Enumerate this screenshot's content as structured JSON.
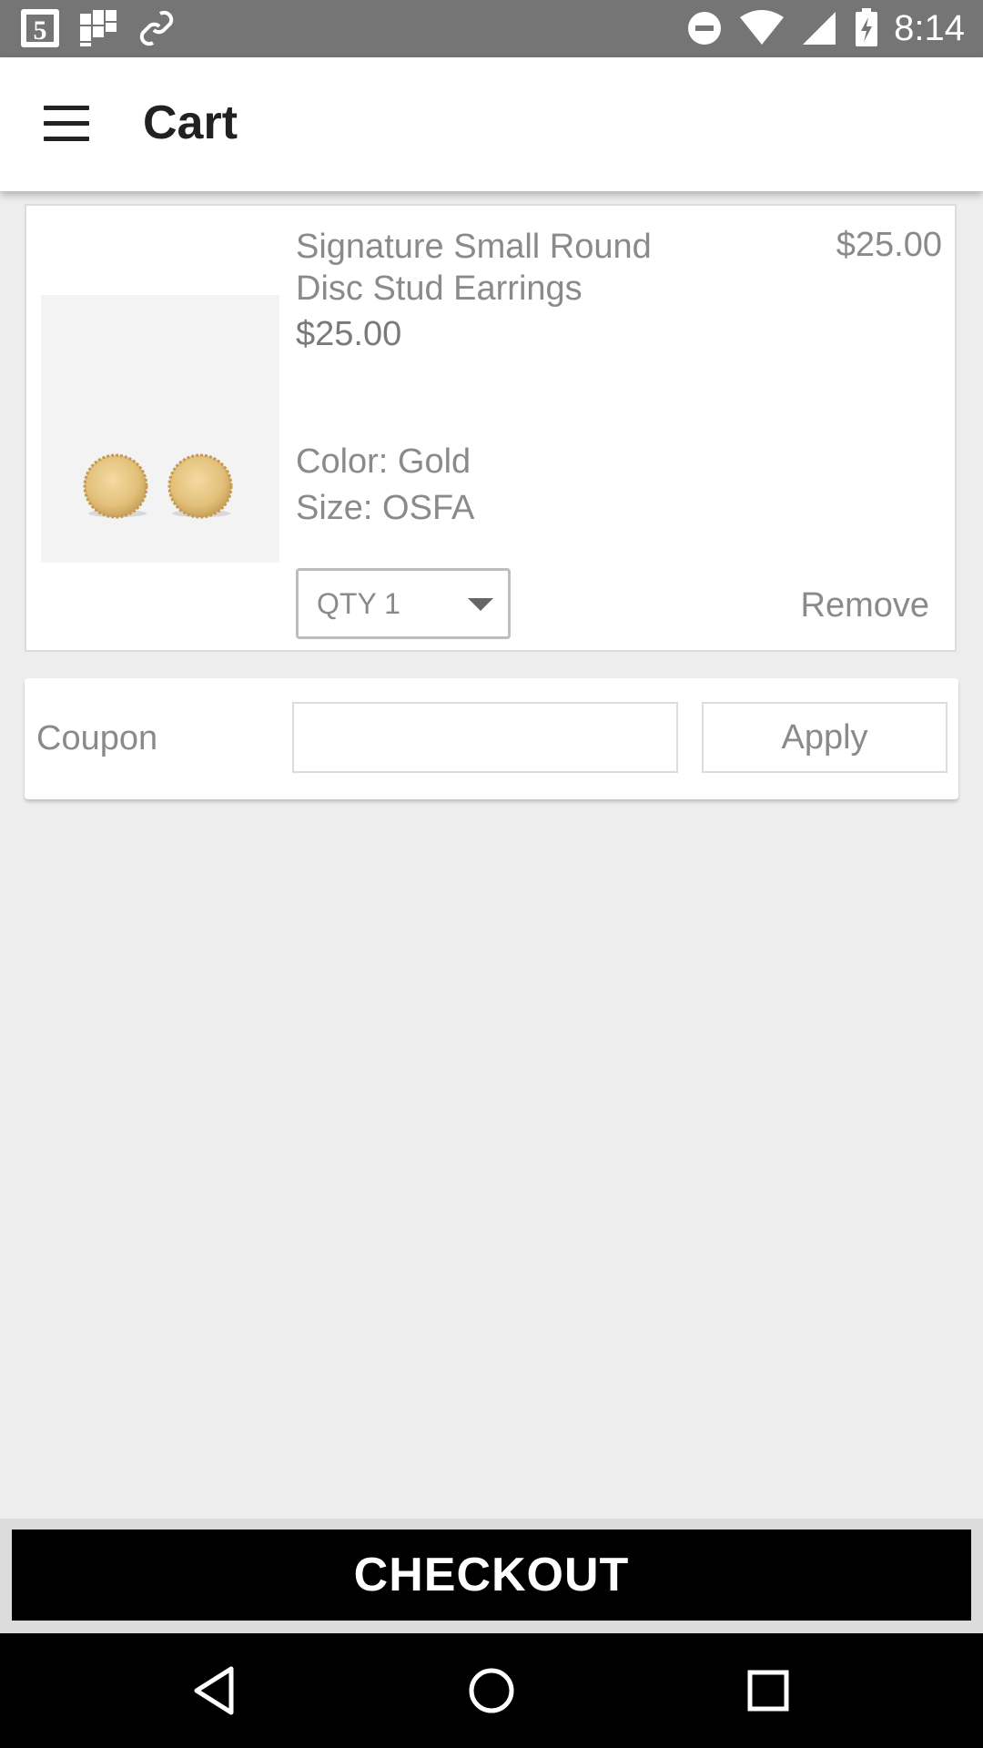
{
  "status_bar": {
    "time": "8:14",
    "left_icons": [
      "channel-5-icon",
      "grid-app-icon",
      "link-app-icon"
    ],
    "right_icons": [
      "do-not-disturb-icon",
      "wifi-icon",
      "signal-icon",
      "battery-charging-icon"
    ]
  },
  "toolbar": {
    "title": "Cart",
    "menu_icon": "hamburger-menu-icon"
  },
  "cart_item": {
    "name": "Signature Small Round Disc Stud Earrings",
    "unit_price": "$25.00",
    "line_price": "$25.00",
    "color": "Color: Gold",
    "size": "Size: OSFA",
    "quantity_label": "QTY 1",
    "remove_label": "Remove",
    "image": "gold-disc-earrings-image"
  },
  "coupon": {
    "label": "Coupon",
    "value": "",
    "placeholder": "",
    "apply_label": "Apply"
  },
  "checkout": {
    "label": "CHECKOUT"
  },
  "nav_bar": {
    "icons": [
      "back-icon",
      "home-icon",
      "recents-icon"
    ]
  }
}
